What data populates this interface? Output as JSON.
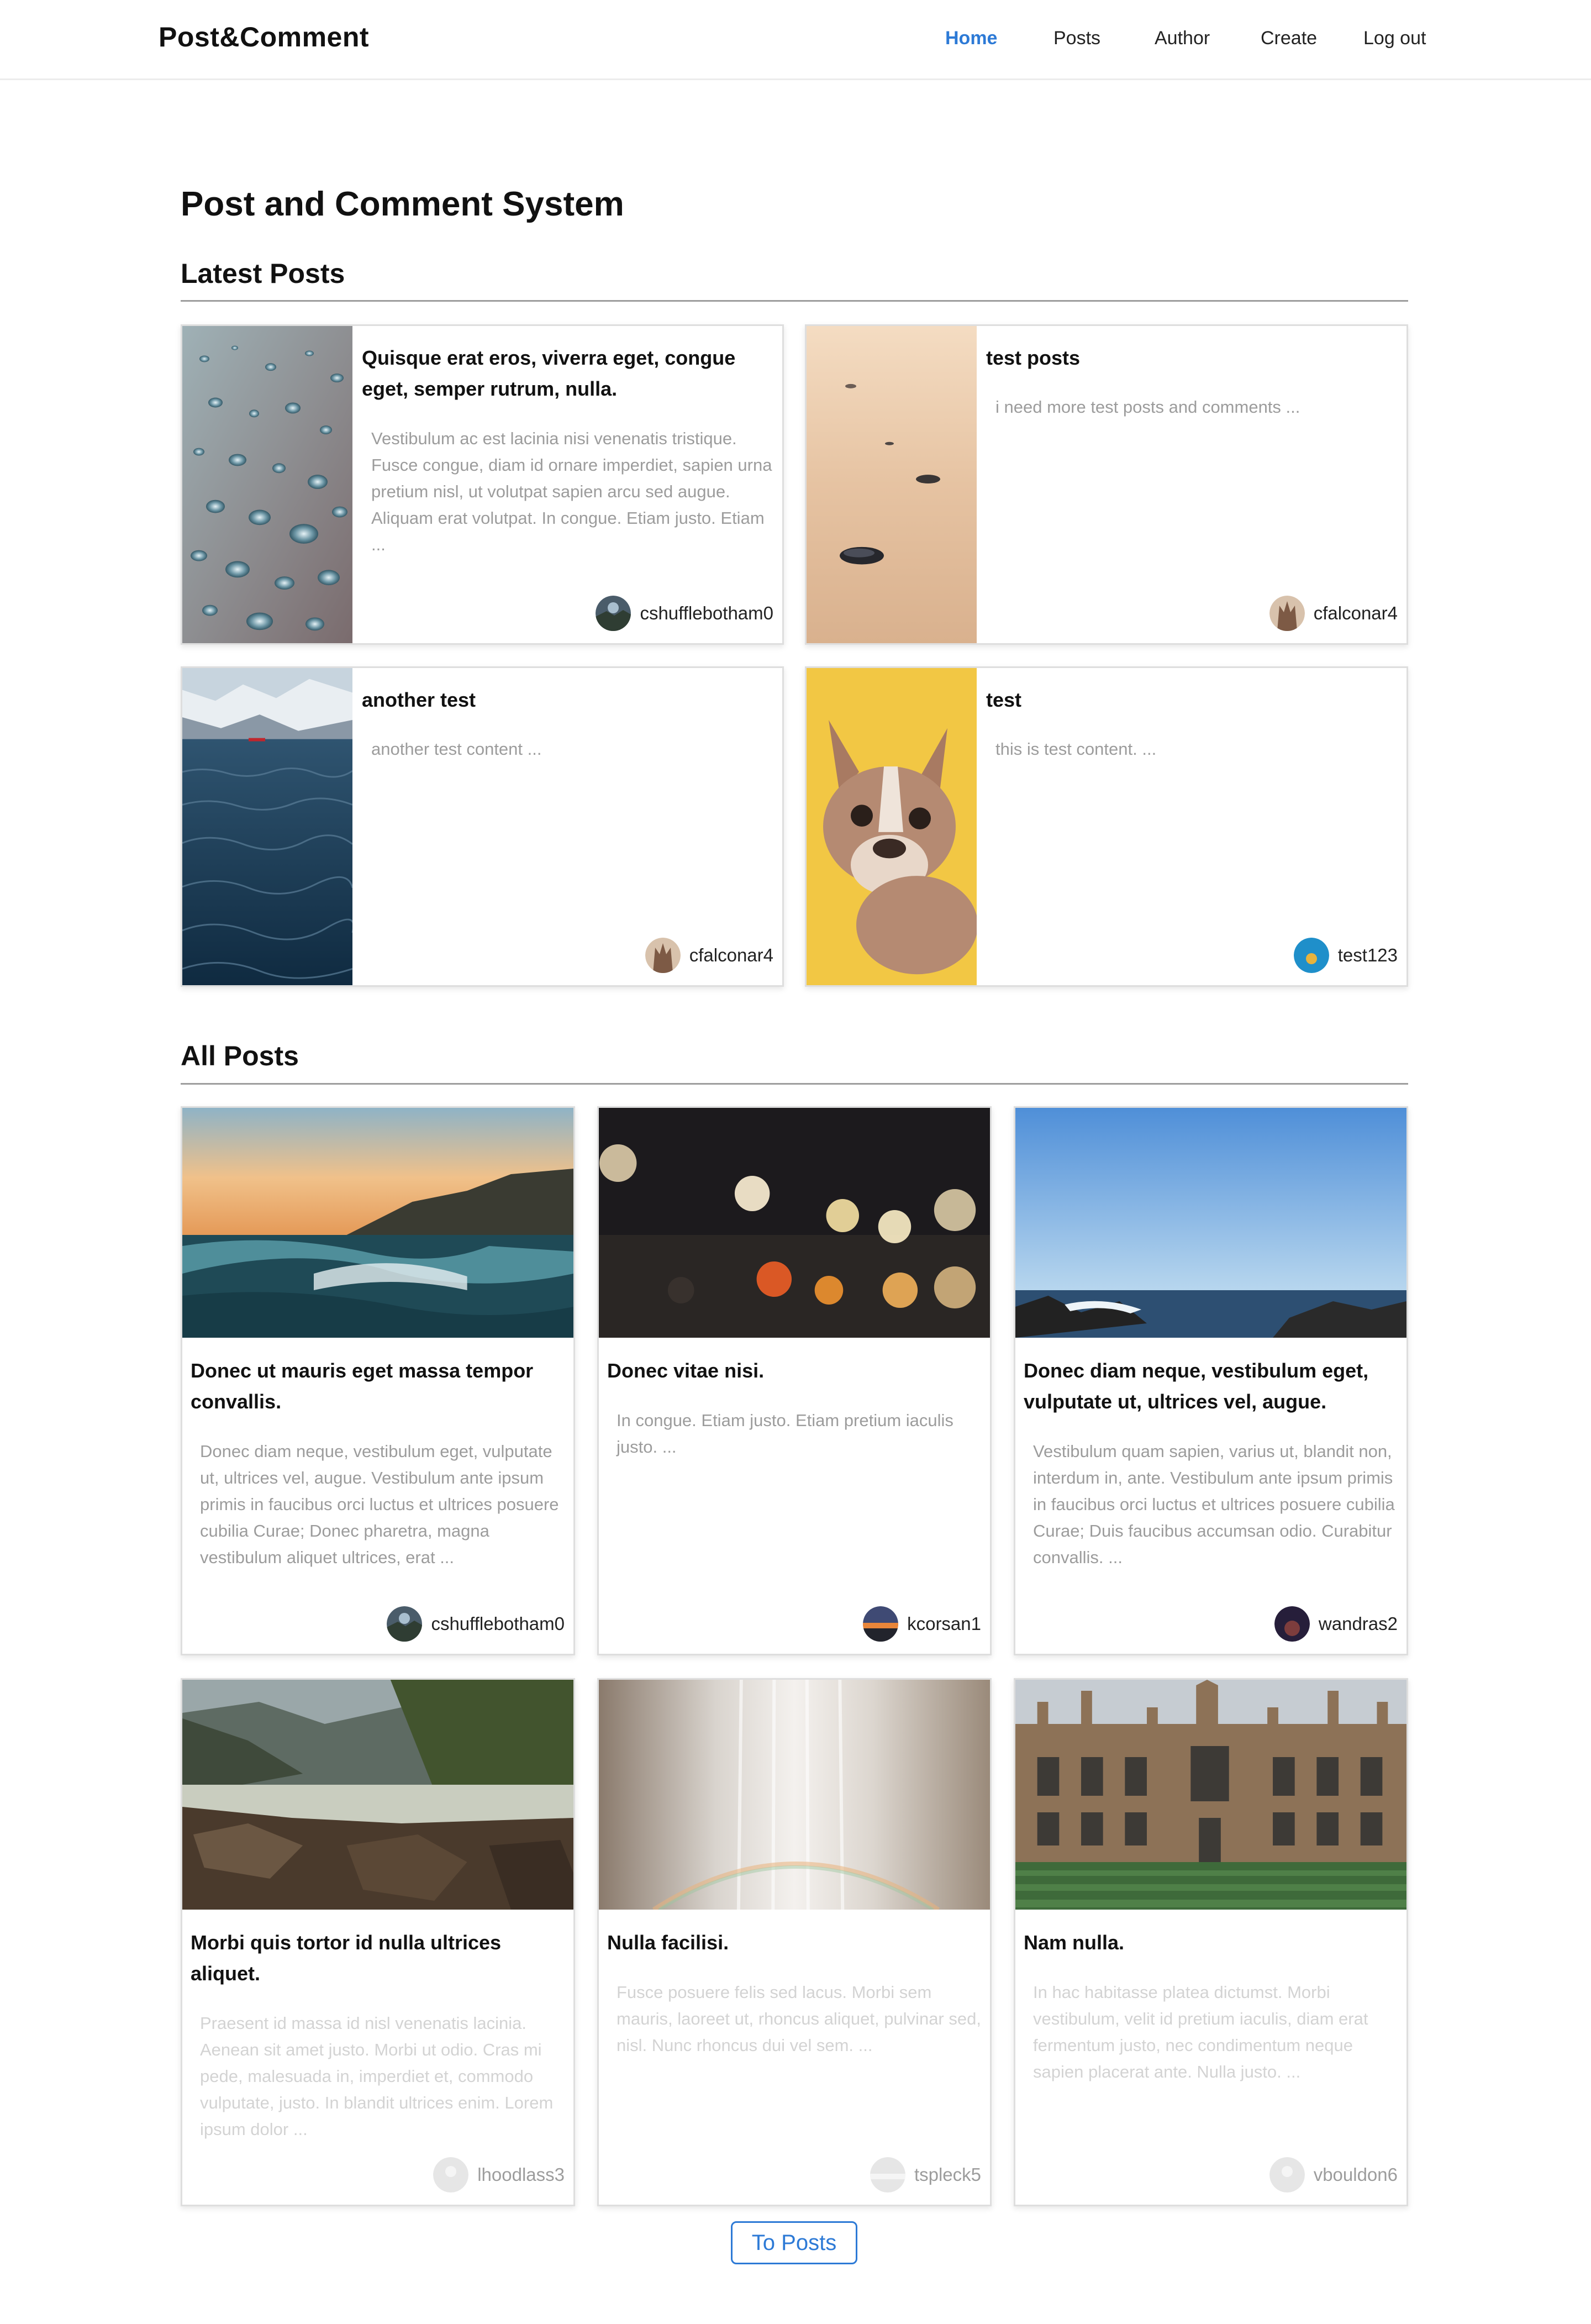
{
  "nav": {
    "brand": "Post&Comment",
    "links": [
      "Home",
      "Posts",
      "Author",
      "Create",
      "Log out"
    ],
    "active": "Home",
    "accent_color": "#2d7ad6"
  },
  "page_title": "Post and Comment System",
  "latest_posts": {
    "heading": "Latest Posts",
    "posts": [
      {
        "title": "Quisque erat eros, viverra eget, congue eget, semper rutrum, nulla.",
        "excerpt": "Vestibulum ac est lacinia nisi venenatis tristique. Fusce congue, diam id ornare imperdiet, sapien urna pretium nisl, ut volutpat sapien arcu sed augue. Aliquam erat volutpat. In congue. Etiam justo. Etiam ...",
        "author": "cshufflebotham0",
        "image": "water-droplets-photo"
      },
      {
        "title": "test posts",
        "excerpt": "i need more test posts and comments ...",
        "author": "cfalconar4",
        "image": "sand-pebbles-photo"
      },
      {
        "title": "another test",
        "excerpt": "another test content ...",
        "author": "cfalconar4",
        "image": "fjord-water-photo"
      },
      {
        "title": "test",
        "excerpt": "this is test content. ...",
        "author": "test123",
        "image": "bulldog-photo"
      }
    ]
  },
  "all_posts": {
    "heading": "All Posts",
    "posts": [
      {
        "title": "Donec ut mauris eget massa tempor convallis.",
        "excerpt": "Donec diam neque, vestibulum eget, vulputate ut, ultrices vel, augue. Vestibulum ante ipsum primis in faucibus orci luctus et ultrices posuere cubilia Curae; Donec pharetra, magna vestibulum aliquet ultrices, erat ...",
        "author": "cshufflebotham0",
        "image": "ocean-wave-sunset-photo"
      },
      {
        "title": "Donec vitae nisi.",
        "excerpt": "In congue. Etiam justo. Etiam pretium iaculis justo. ...",
        "author": "kcorsan1",
        "image": "bokeh-lights-photo"
      },
      {
        "title": "Donec diam neque, vestibulum eget, vulputate ut, ultrices vel, augue.",
        "excerpt": "Vestibulum quam sapien, varius ut, blandit non, interdum in, ante. Vestibulum ante ipsum primis in faucibus orci luctus et ultrices posuere cubilia Curae; Duis faucibus accumsan odio. Curabitur convallis. ...",
        "author": "wandras2",
        "image": "sea-horizon-photo"
      },
      {
        "title": "Morbi quis tortor id nulla ultrices aliquet.",
        "excerpt": "Praesent id massa id nisl venenatis lacinia. Aenean sit amet justo. Morbi ut odio. Cras mi pede, malesuada in, imperdiet et, commodo vulputate, justo. In blandit ultrices enim. Lorem ipsum dolor ...",
        "author": "lhoodlass3",
        "image": "mountain-river-photo"
      },
      {
        "title": "Nulla facilisi.",
        "excerpt": "Fusce posuere felis sed lacus. Morbi sem mauris, laoreet ut, rhoncus aliquet, pulvinar sed, nisl. Nunc rhoncus dui vel sem. ...",
        "author": "tspleck5",
        "image": "waterfall-rainbow-photo"
      },
      {
        "title": "Nam nulla.",
        "excerpt": "In hac habitasse platea dictumst. Morbi vestibulum, velit id pretium iaculis, diam erat fermentum justo, nec condimentum neque sapien placerat ante. Nulla justo. ...",
        "author": "vbouldon6",
        "image": "gothic-college-building-photo"
      }
    ]
  },
  "to_posts_button": "To Posts"
}
